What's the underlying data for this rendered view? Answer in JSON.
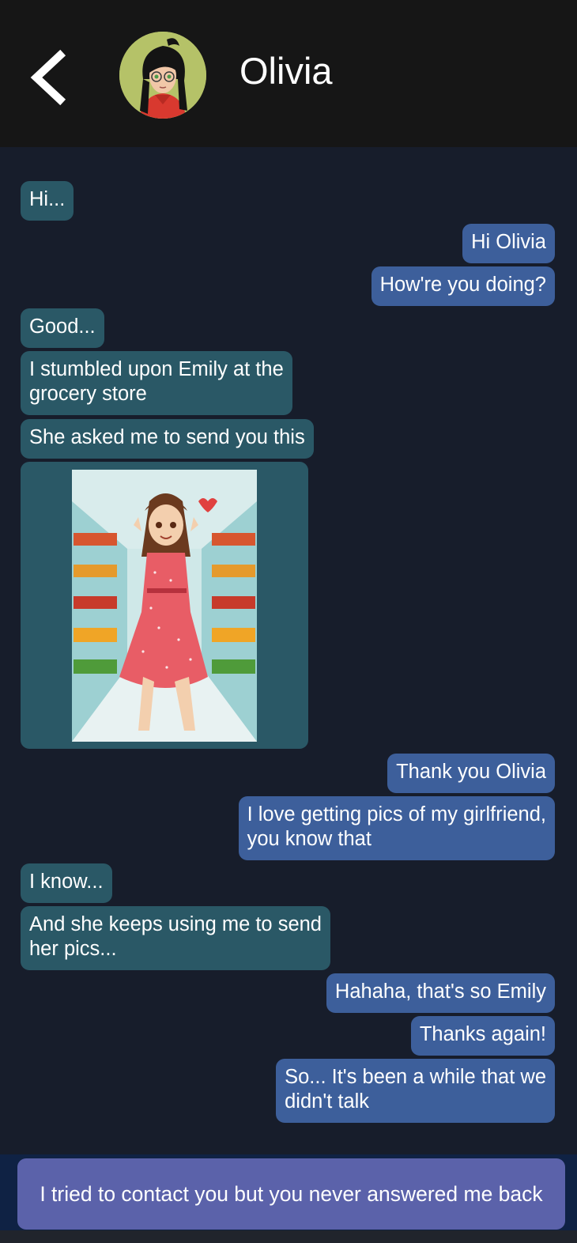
{
  "header": {
    "contact_name": "Olivia",
    "back_icon": "chevron-left-icon",
    "avatar_icon": "contact-avatar"
  },
  "messages": [
    {
      "side": "in",
      "text": "Hi..."
    },
    {
      "side": "out",
      "text": "Hi Olivia"
    },
    {
      "side": "out",
      "text": "How're you doing?"
    },
    {
      "side": "in",
      "text": "Good..."
    },
    {
      "side": "in",
      "line1": "I stumbled upon Emily at the",
      "line2": "grocery store"
    },
    {
      "side": "in",
      "text": "She asked me to send you this"
    },
    {
      "side": "in",
      "type": "image",
      "image_icon": "photo-girl-grocery-aisle"
    },
    {
      "side": "out",
      "text": "Thank you Olivia"
    },
    {
      "side": "out",
      "line1": "I love getting pics of my girlfriend,",
      "line2": "you know that"
    },
    {
      "side": "in",
      "text": "I know..."
    },
    {
      "side": "in",
      "line1": "And she keeps using me to send",
      "line2": "her pics..."
    },
    {
      "side": "out",
      "text": "Hahaha, that's so Emily"
    },
    {
      "side": "out",
      "text": "Thanks again!"
    },
    {
      "side": "out",
      "line1": "So... It's been a while that we",
      "line2": "didn't talk"
    }
  ],
  "reply_choice": {
    "label": "I tried to contact you but you never answered me back"
  },
  "colors": {
    "background": "#171d2b",
    "header": "#161616",
    "incoming_bubble": "#2a5866",
    "outgoing_bubble": "#3d5f9b",
    "reply_button": "#5b62aa",
    "input_bar": "#0f2244"
  }
}
